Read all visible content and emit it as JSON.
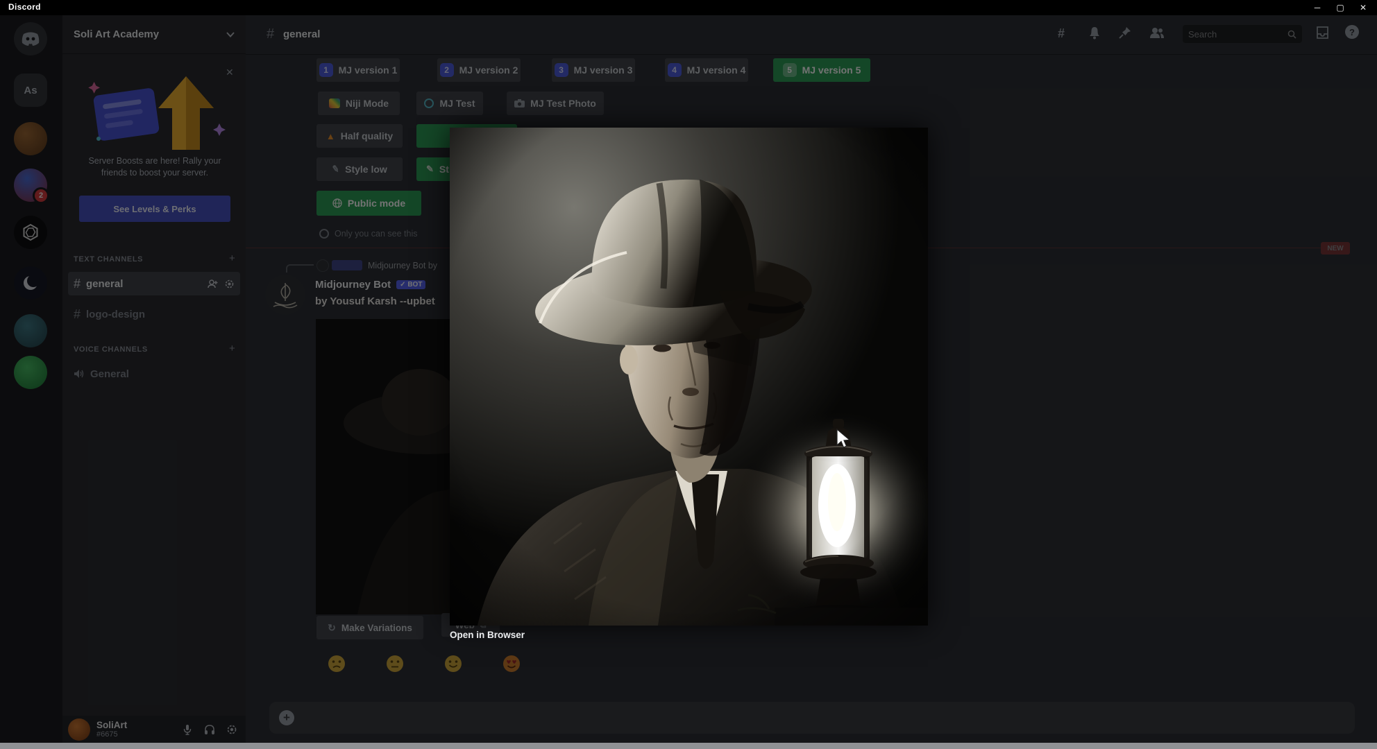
{
  "window": {
    "app_title": "Discord",
    "minimize_glyph": "─",
    "maximize_glyph": "▢",
    "close_glyph": "✕"
  },
  "rail": {
    "servers": [
      {
        "name": "discord-home"
      },
      {
        "name": "server-as",
        "label": "As"
      },
      {
        "name": "server-pet"
      },
      {
        "name": "server-art",
        "badge": "2"
      },
      {
        "name": "server-openai"
      },
      {
        "name": "server-moon"
      },
      {
        "name": "server-teal"
      },
      {
        "name": "server-green"
      }
    ]
  },
  "sidebar": {
    "server_name": "Soli Art Academy",
    "boost": {
      "message": "Server Boosts are here! Rally your friends to boost your server.",
      "cta": "See Levels & Perks",
      "close_glyph": "✕"
    },
    "text_channels_label": "TEXT CHANNELS",
    "voice_channels_label": "VOICE CHANNELS",
    "channels": [
      {
        "name": "general"
      },
      {
        "name": "logo-design"
      }
    ],
    "voice_channels": [
      {
        "name": "General"
      }
    ],
    "user": {
      "name": "SoliArt",
      "tag": "#6675"
    }
  },
  "header": {
    "channel": "general",
    "search_placeholder": "Search"
  },
  "settings": {
    "versions": [
      {
        "num": "1",
        "label": "MJ version 1"
      },
      {
        "num": "2",
        "label": "MJ version 2"
      },
      {
        "num": "3",
        "label": "MJ version 3"
      },
      {
        "num": "4",
        "label": "MJ version 4"
      },
      {
        "num": "5",
        "label": "MJ version 5",
        "selected": true
      }
    ],
    "modes": [
      {
        "label": "Niji Mode"
      },
      {
        "label": "MJ Test"
      },
      {
        "label": "MJ Test Photo"
      }
    ],
    "quality": [
      {
        "label": "Half quality"
      },
      {
        "label": "",
        "selected": true
      }
    ],
    "style": [
      {
        "label": "Style low"
      },
      {
        "label": "St",
        "selected": true
      }
    ],
    "visibility": [
      {
        "label": "Public mode",
        "selected": true
      }
    ],
    "note": "Only you can see this"
  },
  "message": {
    "reply_preview": "Midjourney Bot by",
    "author": "Midjourney Bot",
    "bot_badge": "✓ BOT",
    "prompt": "by Yousuf Karsh --upbet",
    "buttons": [
      {
        "label": "Make Variations"
      },
      {
        "label": "Web"
      }
    ],
    "reactions": [
      {
        "name": "frown-emoji"
      },
      {
        "name": "neutral-emoji"
      },
      {
        "name": "smile-emoji"
      },
      {
        "name": "heart-eyes-emoji"
      }
    ]
  },
  "lightbox": {
    "open_link": "Open in Browser"
  },
  "unread_badge": "NEW",
  "colors": {
    "blurple": "#5865f2",
    "green": "#2d9e58",
    "red_badge": "#d83c3e",
    "boost_arrow": "#f0b132",
    "overlay": "rgba(0,0,0,0.55)"
  }
}
